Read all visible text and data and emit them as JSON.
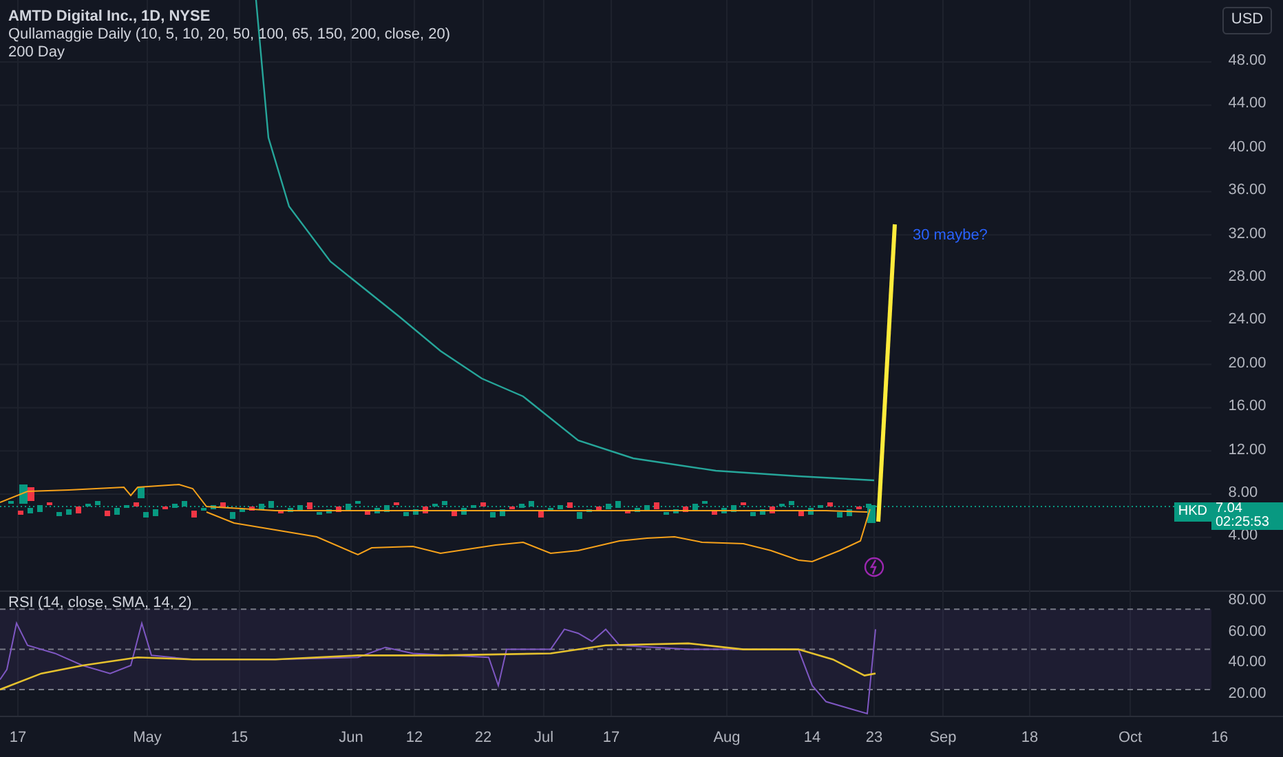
{
  "legend": {
    "symbol": "AMTD Digital Inc., 1D, NYSE",
    "indicators": [
      "Qullamaggie Daily (10, 5, 10, 20, 50, 100, 65, 150, 200, close, 20)",
      "200 Day"
    ]
  },
  "annotation": {
    "text": "30 maybe?",
    "color": "#2962ff"
  },
  "price_axis": {
    "currency": "USD",
    "labels": [
      "48.00",
      "44.00",
      "40.00",
      "36.00",
      "32.00",
      "28.00",
      "24.00",
      "20.00",
      "16.00",
      "12.00",
      "8.00",
      "4.00"
    ]
  },
  "price_tag": {
    "currency": "HKD",
    "price": "7.04",
    "countdown": "02:25:53"
  },
  "rsi": {
    "title": "RSI (14, close, SMA, 14, 2)",
    "labels": [
      "80.00",
      "60.00",
      "40.00",
      "20.00"
    ]
  },
  "time_axis": {
    "labels": [
      "17",
      "May",
      "15",
      "Jun",
      "12",
      "22",
      "Jul",
      "17",
      "Aug",
      "14",
      "23",
      "Sep",
      "18",
      "Oct",
      "16"
    ]
  }
}
